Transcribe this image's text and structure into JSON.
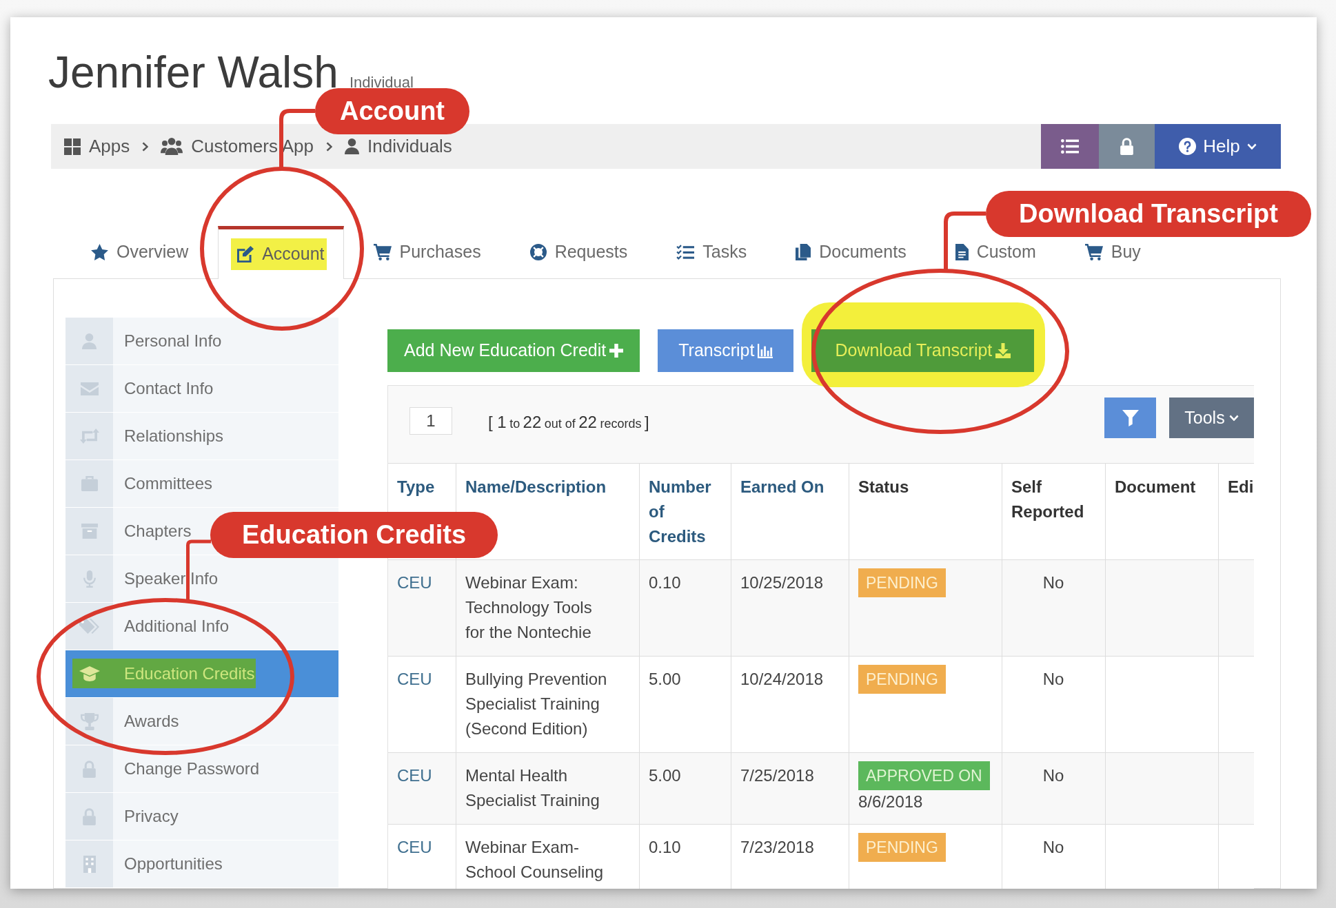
{
  "header": {
    "title": "Jennifer Walsh",
    "subtitle": "Individual"
  },
  "breadcrumb": {
    "items": [
      {
        "label": "Apps"
      },
      {
        "label": "Customers App"
      },
      {
        "label": "Individuals"
      }
    ],
    "help_label": "Help"
  },
  "tabs": [
    {
      "label": "Overview",
      "selected": false,
      "highlighted": false
    },
    {
      "label": "Account",
      "selected": true,
      "highlighted": true
    },
    {
      "label": "Purchases",
      "selected": false,
      "highlighted": false
    },
    {
      "label": "Requests",
      "selected": false,
      "highlighted": false
    },
    {
      "label": "Tasks",
      "selected": false,
      "highlighted": false
    },
    {
      "label": "Documents",
      "selected": false,
      "highlighted": false
    },
    {
      "label": "Custom",
      "selected": false,
      "highlighted": false
    },
    {
      "label": "Buy",
      "selected": false,
      "highlighted": false
    }
  ],
  "sidebar": {
    "items": [
      {
        "label": "Personal Info",
        "selected": false,
        "highlighted": false
      },
      {
        "label": "Contact Info",
        "selected": false,
        "highlighted": false
      },
      {
        "label": "Relationships",
        "selected": false,
        "highlighted": false
      },
      {
        "label": "Committees",
        "selected": false,
        "highlighted": false
      },
      {
        "label": "Chapters",
        "selected": false,
        "highlighted": false
      },
      {
        "label": "Speaker Info",
        "selected": false,
        "highlighted": false
      },
      {
        "label": "Additional Info",
        "selected": false,
        "highlighted": false
      },
      {
        "label": "Education Credits",
        "selected": true,
        "highlighted": true
      },
      {
        "label": "Awards",
        "selected": false,
        "highlighted": false
      },
      {
        "label": "Change Password",
        "selected": false,
        "highlighted": false
      },
      {
        "label": "Privacy",
        "selected": false,
        "highlighted": false
      },
      {
        "label": "Opportunities",
        "selected": false,
        "highlighted": false
      }
    ]
  },
  "actions": [
    {
      "label": "Add New Education Credit",
      "kind": "add",
      "highlighted": false
    },
    {
      "label": "Transcript",
      "kind": "report",
      "highlighted": false
    },
    {
      "label": "Download Transcript",
      "kind": "download",
      "highlighted": true
    }
  ],
  "table": {
    "page": "1",
    "summary": [
      {
        "text": "[ 1",
        "kind": "big"
      },
      {
        "text": "to",
        "kind": "small"
      },
      {
        "text": "22",
        "kind": "big"
      },
      {
        "text": "out of",
        "kind": "small"
      },
      {
        "text": "22",
        "kind": "big"
      },
      {
        "text": "records",
        "kind": "small"
      },
      {
        "text": "]",
        "kind": "big"
      }
    ],
    "tools_label": "Tools",
    "columns": [
      {
        "label": "Type",
        "sortable": true
      },
      {
        "label": "Name/Description",
        "sortable": true
      },
      {
        "label": "Number of Credits",
        "sortable": true
      },
      {
        "label": "Earned On",
        "sortable": true
      },
      {
        "label": "Status",
        "sortable": false
      },
      {
        "label": "Self Reported",
        "sortable": false
      },
      {
        "label": "Document",
        "sortable": false
      },
      {
        "label": "Edi",
        "sortable": false
      }
    ],
    "rows": [
      {
        "type": "CEU",
        "description": "Webinar Exam: Technology Tools for the Nontechie",
        "credits": "0.10",
        "earned_on": "10/25/2018",
        "status": {
          "label": "PENDING",
          "kind": "pending"
        },
        "self_reported": "No"
      },
      {
        "type": "CEU",
        "description": "Bullying Prevention Specialist Training (Second Edition)",
        "credits": "5.00",
        "earned_on": "10/24/2018",
        "status": {
          "label": "PENDING",
          "kind": "pending"
        },
        "self_reported": "No"
      },
      {
        "type": "CEU",
        "description": "Mental Health Specialist Training",
        "credits": "5.00",
        "earned_on": "7/25/2018",
        "status": {
          "label": "APPROVED ON",
          "kind": "approved",
          "date": "8/6/2018"
        },
        "self_reported": "No"
      },
      {
        "type": "CEU",
        "description": "Webinar Exam- School Counseling",
        "credits": "0.10",
        "earned_on": "7/23/2018",
        "status": {
          "label": "PENDING",
          "kind": "pending"
        },
        "self_reported": "No"
      }
    ]
  },
  "callouts": [
    {
      "label": "Account"
    },
    {
      "label": "Download Transcript"
    },
    {
      "label": "Education Credits"
    }
  ]
}
